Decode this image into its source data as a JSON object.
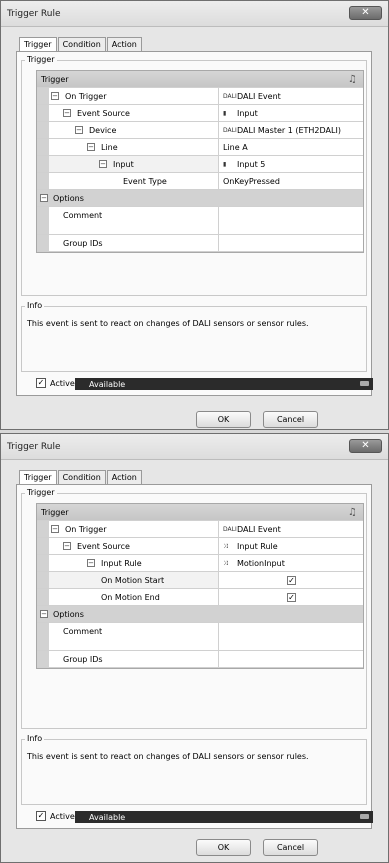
{
  "dialogs": [
    {
      "title": "Trigger Rule",
      "close": "✕",
      "tabs": [
        "Trigger",
        "Condition",
        "Action"
      ],
      "trigger_group": "Trigger",
      "grid_header": "Trigger",
      "rows": [
        {
          "label": "On Trigger",
          "value": "DALI Event"
        },
        {
          "label": "Event Source",
          "value": "Input"
        },
        {
          "label": "Device",
          "value": "DALI Master 1 (ETH2DALI)"
        },
        {
          "label": "Line",
          "value": "Line A"
        },
        {
          "label": "Input",
          "value": "Input 5"
        },
        {
          "label": "Event Type",
          "value": "OnKeyPressed"
        }
      ],
      "options_label": "Options",
      "comment_label": "Comment",
      "group_ids_label": "Group IDs",
      "info_group": "Info",
      "info_text": "This event is sent to react on changes of DALI sensors or sensor rules.",
      "active_label": "Active",
      "status": "Available",
      "ok": "OK",
      "cancel": "Cancel"
    },
    {
      "title": "Trigger Rule",
      "close": "✕",
      "tabs": [
        "Trigger",
        "Condition",
        "Action"
      ],
      "trigger_group": "Trigger",
      "grid_header": "Trigger",
      "rows": [
        {
          "label": "On Trigger",
          "value": "DALI Event"
        },
        {
          "label": "Event Source",
          "value": "Input Rule"
        },
        {
          "label": "Input Rule",
          "value": "MotionInput"
        },
        {
          "label": "On Motion Start",
          "value": "✓"
        },
        {
          "label": "On Motion End",
          "value": "✓"
        }
      ],
      "options_label": "Options",
      "comment_label": "Comment",
      "group_ids_label": "Group IDs",
      "info_group": "Info",
      "info_text": "This event is sent to react on changes of DALI sensors or sensor rules.",
      "active_label": "Active",
      "status": "Available",
      "ok": "OK",
      "cancel": "Cancel"
    }
  ],
  "icons": {
    "dali": "DALI",
    "input": "▮",
    "rule": "⤨",
    "header": "♫"
  }
}
